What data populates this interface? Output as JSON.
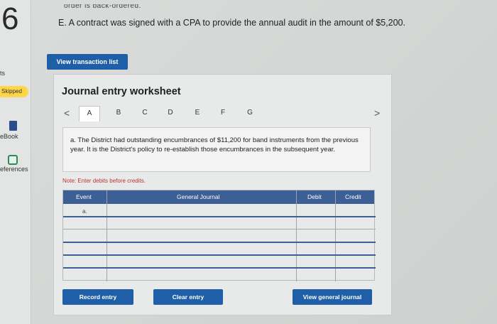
{
  "question_number": "6",
  "sidebar": {
    "partial_top_label": "ts",
    "skipped_label": "Skipped",
    "ebook_label": "eBook",
    "references_label": "eferences"
  },
  "header": {
    "cutoff_line": "order is back-ordered.",
    "statement": "E. A contract was signed with a CPA to provide the annual audit in the amount of $5,200."
  },
  "view_transactions_label": "View transaction list",
  "worksheet": {
    "title": "Journal entry worksheet",
    "prev_arrow": "<",
    "next_arrow": ">",
    "tabs": [
      "A",
      "B",
      "C",
      "D",
      "E",
      "F",
      "G"
    ],
    "active_tab": "A",
    "description": "a. The District had outstanding encumbrances of $11,200 for band instruments from the previous year. It is the District's policy to re-establish those encumbrances in the subsequent year.",
    "note": "Note: Enter debits before credits.",
    "columns": [
      "Event",
      "General Journal",
      "Debit",
      "Credit"
    ],
    "rows": [
      {
        "event": "a.",
        "account": "",
        "debit": "",
        "credit": ""
      },
      {
        "event": "",
        "account": "",
        "debit": "",
        "credit": ""
      },
      {
        "event": "",
        "account": "",
        "debit": "",
        "credit": ""
      },
      {
        "event": "",
        "account": "",
        "debit": "",
        "credit": ""
      },
      {
        "event": "",
        "account": "",
        "debit": "",
        "credit": ""
      },
      {
        "event": "",
        "account": "",
        "debit": "",
        "credit": ""
      }
    ]
  },
  "buttons": {
    "record": "Record entry",
    "clear": "Clear entry",
    "view_journal": "View general journal"
  },
  "colors": {
    "primary_button": "#1f5fa8",
    "grid_header": "#3c5f96",
    "skipped_badge": "#ffd54a",
    "note_text": "#b33333"
  }
}
